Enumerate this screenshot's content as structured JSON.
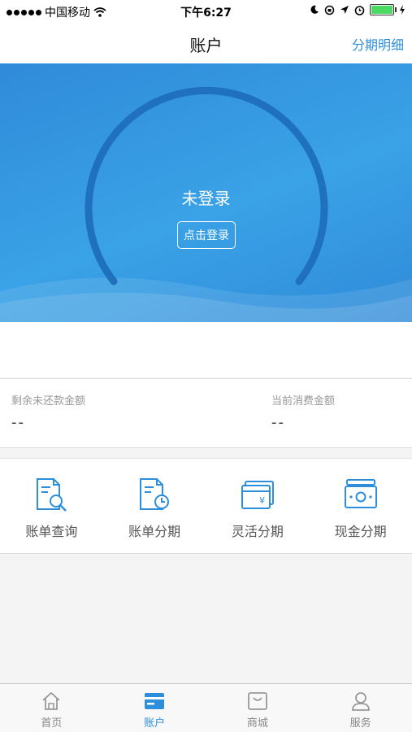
{
  "status_bar": {
    "carrier": "中国移动",
    "time": "下午6:27"
  },
  "nav": {
    "title": "账户",
    "right_link": "分期明细"
  },
  "hero": {
    "status": "未登录",
    "login_button": "点击登录"
  },
  "amounts": [
    {
      "label": "剩余未还款金额",
      "value": "--"
    },
    {
      "label": "当前消费金额",
      "value": "--"
    }
  ],
  "services": [
    {
      "label": "账单查询",
      "icon": "bill-search-icon"
    },
    {
      "label": "账单分期",
      "icon": "bill-clock-icon"
    },
    {
      "label": "灵活分期",
      "icon": "yen-card-icon"
    },
    {
      "label": "现金分期",
      "icon": "cash-icon"
    }
  ],
  "tabs": [
    {
      "label": "首页",
      "icon": "home-icon",
      "active": false
    },
    {
      "label": "账户",
      "icon": "wallet-icon",
      "active": true
    },
    {
      "label": "商城",
      "icon": "shopping-bag-icon",
      "active": false
    },
    {
      "label": "服务",
      "icon": "user-icon",
      "active": false
    }
  ],
  "colors": {
    "accent": "#2d8fdc",
    "hero_bg": "#3399e0",
    "arc": "#1f70bd",
    "battery": "#4cd964"
  }
}
